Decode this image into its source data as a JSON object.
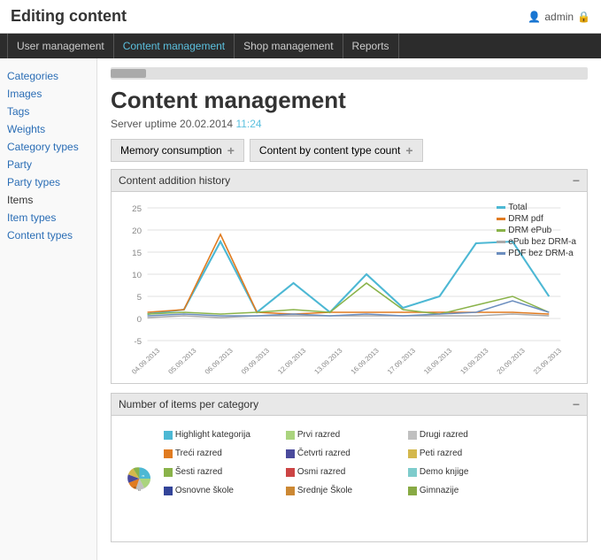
{
  "header": {
    "title": "Editing content",
    "user": "admin"
  },
  "navbar": {
    "items": [
      {
        "label": "User management",
        "active": false
      },
      {
        "label": "Content management",
        "active": true
      },
      {
        "label": "Shop management",
        "active": false
      },
      {
        "label": "Reports",
        "active": false
      }
    ]
  },
  "sidebar": {
    "links": [
      {
        "label": "Categories",
        "blue": true
      },
      {
        "label": "Images",
        "blue": true
      },
      {
        "label": "Tags",
        "blue": true
      },
      {
        "label": "Weights",
        "blue": true
      },
      {
        "label": "Category types",
        "blue": true
      },
      {
        "label": "Party",
        "blue": true
      },
      {
        "label": "Party types",
        "blue": true
      },
      {
        "label": "Items",
        "blue": false
      },
      {
        "label": "Item types",
        "blue": true
      },
      {
        "label": "Content types",
        "blue": true
      }
    ]
  },
  "main": {
    "page_title": "Content management",
    "server_uptime_label": "Server uptime",
    "server_uptime_date": "20.02.2014",
    "server_uptime_time": "11:24",
    "widget_btn1": "Memory consumption",
    "widget_btn2": "Content by content type count",
    "chart1_title": "Content addition history",
    "chart2_title": "Number of items per category",
    "legend": {
      "items": [
        {
          "label": "Total",
          "color": "#4db8d4"
        },
        {
          "label": "DRM pdf",
          "color": "#e07b20"
        },
        {
          "label": "DRM ePub",
          "color": "#8ab34a"
        },
        {
          "label": "ePub bez DRM-a",
          "color": "#aaaaaa"
        },
        {
          "label": "PDF bez DRM-a",
          "color": "#6c8ebf"
        }
      ]
    },
    "xaxis_labels": [
      "04.09.2013",
      "05.09.2013",
      "06.09.2013",
      "09.09.2013",
      "12.09.2013",
      "13.09.2013",
      "16.09.2013",
      "17.09.2013",
      "18.09.2013",
      "19.09.2013",
      "20.09.2013",
      "23.09.2013"
    ],
    "pie_legend": [
      {
        "label": "Highlight kategorija",
        "color": "#4db8d4"
      },
      {
        "label": "Prvi razred",
        "color": "#aad47e"
      },
      {
        "label": "Drugi razred",
        "color": "#c0c0c0"
      },
      {
        "label": "Treći razred",
        "color": "#e07b20"
      },
      {
        "label": "Četvrti razred",
        "color": "#4a4a9c"
      },
      {
        "label": "Peti razred",
        "color": "#d4b84d"
      },
      {
        "label": "Šesti razred",
        "color": "#8ab34a"
      },
      {
        "label": "Osmi razred",
        "color": "#cc4444"
      },
      {
        "label": "Demo knjige",
        "color": "#7ecccc"
      },
      {
        "label": "Osnovne škole",
        "color": "#334499"
      },
      {
        "label": "Srednje Škole",
        "color": "#cc8833"
      },
      {
        "label": "Gimnazije",
        "color": "#88aa44"
      }
    ]
  }
}
